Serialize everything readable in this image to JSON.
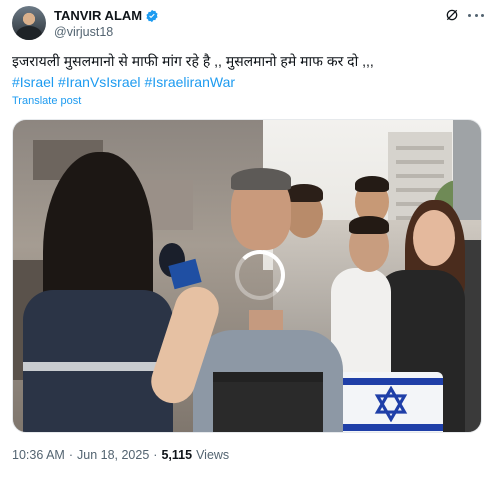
{
  "author": {
    "display_name": "TANVIR ALAM",
    "handle": "@virjust18",
    "verified": true
  },
  "post": {
    "text": "इजरायली मुसलमानो से माफी मांग रहे है ,, मुसलमानो हमे माफ कर दो ,,,",
    "hashtags": [
      "#Israel",
      "#IranVsIsrael",
      "#IsraeliranWar"
    ],
    "translate_label": "Translate post"
  },
  "media": {
    "type": "video",
    "state": "loading",
    "alt": "",
    "reporter_mic_label": "i24"
  },
  "meta": {
    "time": "10:36 AM",
    "separator": "·",
    "date": "Jun 18, 2025",
    "views_count": "5,115",
    "views_label": "Views"
  },
  "icons": {
    "verified": "verified-badge-icon",
    "grok": "grok-icon",
    "more": "more-options-icon",
    "spinner": "loading-spinner-icon"
  },
  "colors": {
    "accent": "#1d9bf0",
    "text_primary": "#0f1419",
    "text_secondary": "#536471"
  }
}
